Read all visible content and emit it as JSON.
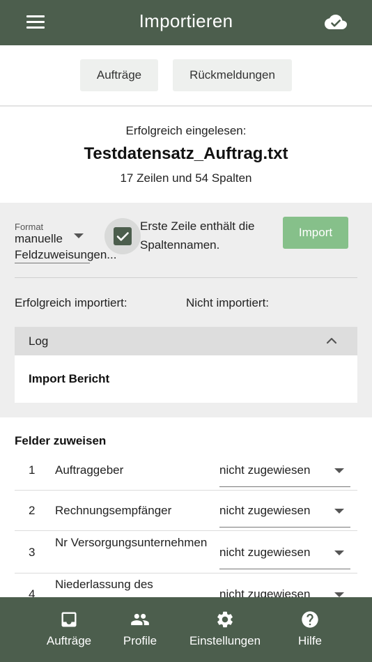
{
  "appbar": {
    "title": "Importieren",
    "menu_icon": "menu-icon",
    "status_icon": "cloud-done-icon"
  },
  "tabs": [
    {
      "label": "Aufträge"
    },
    {
      "label": "Rückmeldungen"
    }
  ],
  "summary": {
    "status": "Erfolgreich eingelesen:",
    "filename": "Testdatensatz_Auftrag.txt",
    "dimensions": "17 Zeilen und 54 Spalten"
  },
  "options": {
    "format_label": "Format",
    "format_value": "manuelle Feldzuweisungen...",
    "header_checkbox_label": "Erste Zeile enthält die Spaltennamen.",
    "header_checkbox_checked": true,
    "import_button": "Import"
  },
  "results": {
    "success_label": "Erfolgreich importiert:",
    "failed_label": "Nicht importiert:"
  },
  "log": {
    "title": "Log",
    "report_title": "Import Bericht",
    "expanded": true
  },
  "fields": {
    "title": "Felder zuweisen",
    "rows": [
      {
        "num": "1",
        "name": "Auftraggeber",
        "value": "nicht zugewiesen"
      },
      {
        "num": "2",
        "name": "Rechnungsempfänger",
        "value": "nicht zugewiesen"
      },
      {
        "num": "3",
        "name": "Nr Versorgungsunternehmen",
        "value": "nicht zugewiesen"
      },
      {
        "num": "4",
        "name": "Niederlassung des",
        "value": "nicht zugewiesen"
      }
    ]
  },
  "bottom_nav": [
    {
      "label": "Aufträge",
      "icon": "inbox-icon"
    },
    {
      "label": "Profile",
      "icon": "people-icon"
    },
    {
      "label": "Einstellungen",
      "icon": "gear-icon"
    },
    {
      "label": "Hilfe",
      "icon": "help-icon"
    }
  ],
  "colors": {
    "primary": "#4c5e4d",
    "import_button": "#86c08a",
    "panel_bg": "#eeeeee"
  }
}
